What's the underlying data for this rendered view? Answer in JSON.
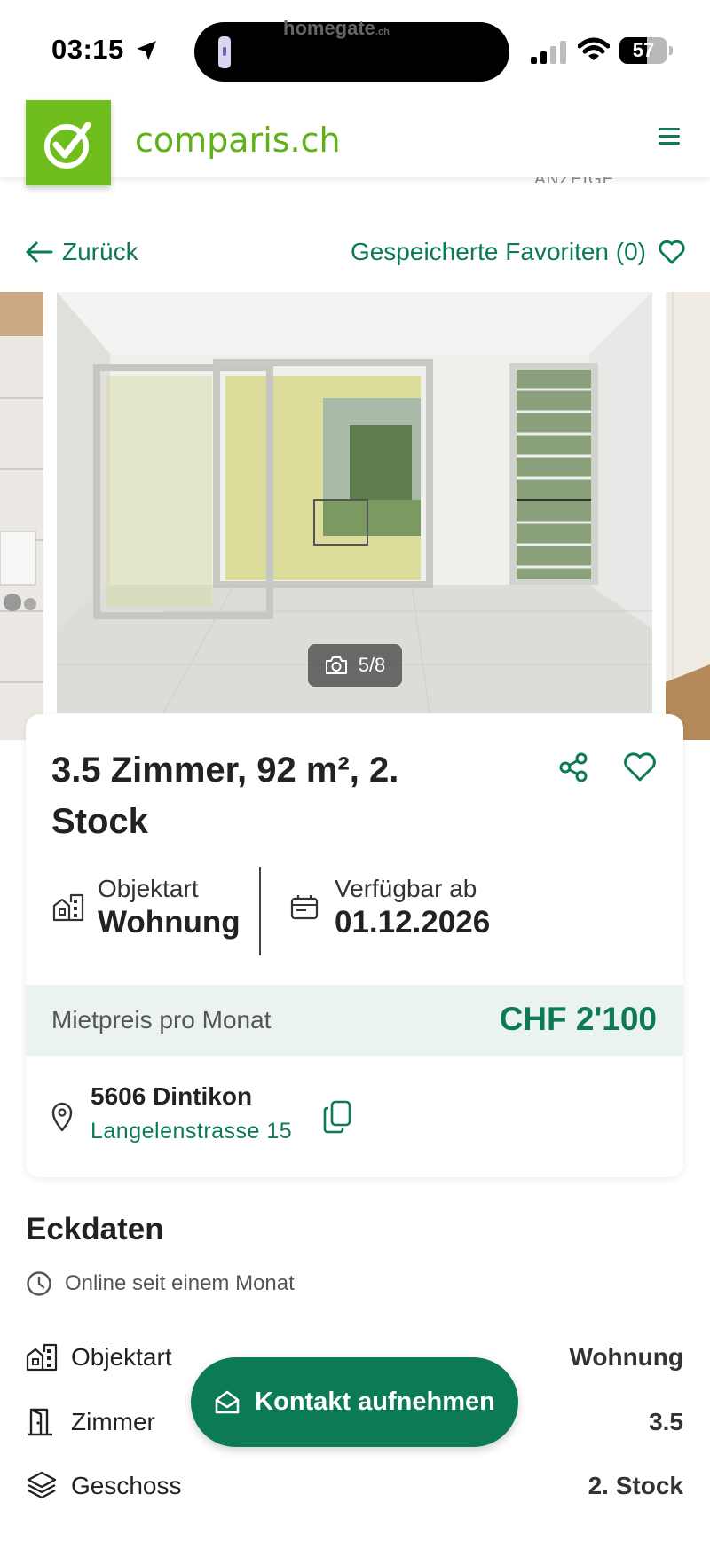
{
  "status_bar": {
    "time": "03:15",
    "island_app": "homegate",
    "island_app_suffix": ".ch",
    "battery": "57",
    "battery_level": 0.57
  },
  "header": {
    "logo_text": "comparis.ch",
    "ad_label": "ANZEIGE",
    "brand_color": "#6fbe1e",
    "accent_color": "#0b7a55"
  },
  "nav": {
    "back_label": "Zurück",
    "favorites_label": "Gespeicherte Favoriten (0)"
  },
  "gallery": {
    "counter": "5/8"
  },
  "listing": {
    "title": "3.5 Zimmer, 92 m², 2. Stock",
    "object_type_label": "Objektart",
    "object_type_value": "Wohnung",
    "available_label": "Verfügbar ab",
    "available_value": "01.12.2026",
    "price_label": "Mietpreis pro Monat",
    "price_value": "CHF 2'100",
    "city": "5606 Dintikon",
    "street": "Langelenstrasse 15"
  },
  "key_data": {
    "title": "Eckdaten",
    "online_since": "Online seit einem Monat",
    "rows": [
      {
        "label": "Objektart",
        "value": "Wohnung",
        "icon": "building-icon"
      },
      {
        "label": "Zimmer",
        "value": "3.5",
        "icon": "door-icon"
      },
      {
        "label": "Geschoss",
        "value": "2. Stock",
        "icon": "layers-icon"
      }
    ]
  },
  "contact": {
    "label": "Kontakt aufnehmen"
  }
}
